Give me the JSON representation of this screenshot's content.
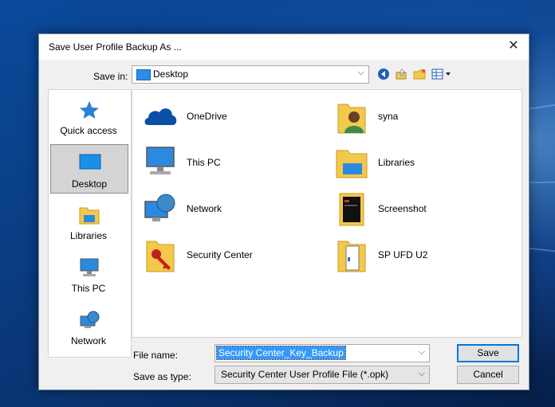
{
  "window": {
    "title": "Save User Profile Backup As ...",
    "close_glyph": "✕"
  },
  "toolbar": {
    "save_in_label": "Save in:",
    "save_in_value": "Desktop",
    "icons": [
      "back-icon",
      "up-folder-icon",
      "new-folder-icon",
      "view-menu-icon"
    ]
  },
  "places": [
    {
      "label": "Quick access",
      "icon": "star-icon",
      "selected": false
    },
    {
      "label": "Desktop",
      "icon": "desktop-icon",
      "selected": true
    },
    {
      "label": "Libraries",
      "icon": "libraries-icon",
      "selected": false
    },
    {
      "label": "This PC",
      "icon": "computer-icon",
      "selected": false
    },
    {
      "label": "Network",
      "icon": "network-icon",
      "selected": false
    }
  ],
  "files": [
    {
      "label": "OneDrive",
      "icon": "onedrive-icon"
    },
    {
      "label": "syna",
      "icon": "user-folder-icon"
    },
    {
      "label": "This PC",
      "icon": "computer-icon"
    },
    {
      "label": "Libraries",
      "icon": "libraries-icon"
    },
    {
      "label": "Network",
      "icon": "network-icon"
    },
    {
      "label": "Screenshot",
      "icon": "screenshot-folder-icon"
    },
    {
      "label": "Security Center",
      "icon": "security-folder-icon"
    },
    {
      "label": "SP UFD U2",
      "icon": "drive-folder-icon"
    }
  ],
  "form": {
    "file_name_label": "File name:",
    "file_name_value": "Security Center_Key_Backup",
    "save_as_type_label": "Save as type:",
    "save_as_type_value": "Security Center User Profile File (*.opk)",
    "save_label": "Save",
    "cancel_label": "Cancel"
  },
  "colors": {
    "accent": "#0078d7",
    "selection": "#3399ff",
    "desktop_bg": "#0a3a78"
  }
}
